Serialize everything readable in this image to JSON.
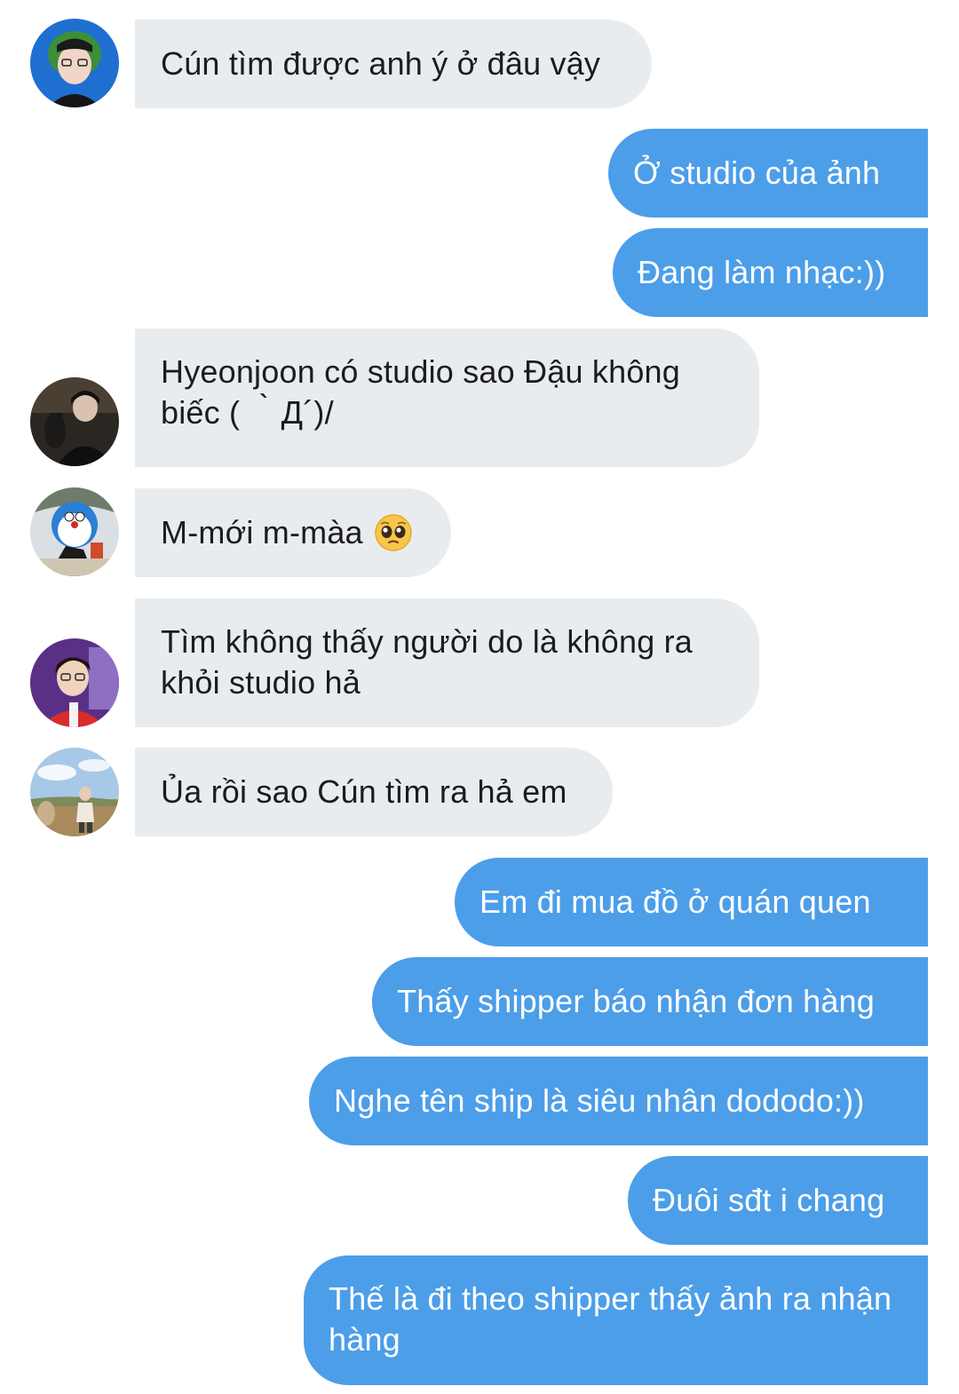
{
  "messages": [
    {
      "side": "in",
      "text": "Cún tìm được anh ý ở đâu vậy",
      "avatar": "avatar-1"
    },
    {
      "side": "out",
      "text": "Ở studio của ảnh"
    },
    {
      "side": "out",
      "text": "Đang làm nhạc:))"
    },
    {
      "side": "in",
      "text": "Hyeonjoon có studio sao Đậu không biếc ( ｀Д´)/",
      "avatar": "avatar-2"
    },
    {
      "side": "in",
      "text": "M-mới m-màa",
      "emoji": "pleading-face-emoji",
      "avatar": "avatar-3"
    },
    {
      "side": "in",
      "text": "Tìm không thấy người do là không ra khỏi studio hả",
      "avatar": "avatar-4"
    },
    {
      "side": "in",
      "text": "Ủa rồi sao Cún tìm ra hả em",
      "avatar": "avatar-5"
    },
    {
      "side": "out",
      "text": "Em đi mua đồ ở quán quen"
    },
    {
      "side": "out",
      "text": "Thấy shipper báo nhận đơn hàng"
    },
    {
      "side": "out",
      "text": "Nghe tên ship là siêu nhân dododo:))"
    },
    {
      "side": "out",
      "text": "Đuôi sđt i chang"
    },
    {
      "side": "out",
      "text": "Thế là đi theo shipper thấy ảnh ra nhận hàng"
    }
  ],
  "colors": {
    "incoming_bubble": "#e9ecef",
    "outgoing_bubble": "#4c9ee9",
    "incoming_text": "#1c1c1c",
    "outgoing_text": "#ffffff"
  }
}
